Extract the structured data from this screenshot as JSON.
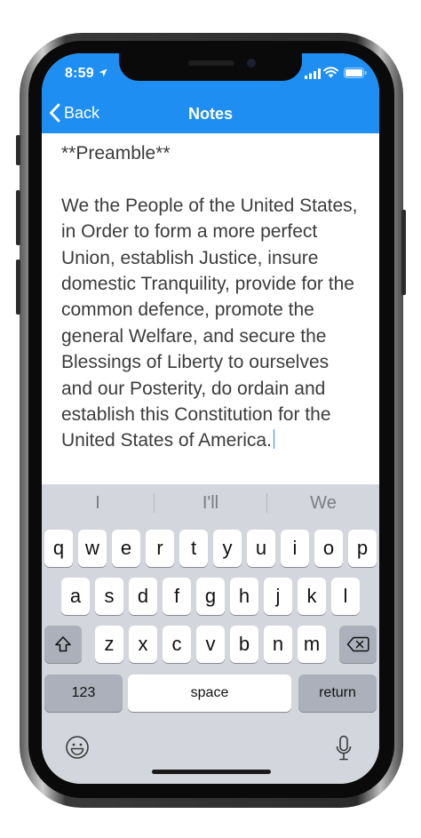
{
  "status": {
    "time": "8:59"
  },
  "nav": {
    "back_label": "Back",
    "title": "Notes"
  },
  "note": {
    "heading": "**Preamble**",
    "body": "We the People of the United States, in Order to form a more perfect Union, establish Justice, insure domestic Tranquility, provide for the common defence, promote the general Welfare, and secure the Blessings of Liberty to ourselves and our Posterity, do ordain and establish this Constitution for the United States of America."
  },
  "suggestions": [
    "I",
    "I'll",
    "We"
  ],
  "keyboard": {
    "row1": [
      "q",
      "w",
      "e",
      "r",
      "t",
      "y",
      "u",
      "i",
      "o",
      "p"
    ],
    "row2": [
      "a",
      "s",
      "d",
      "f",
      "g",
      "h",
      "j",
      "k",
      "l"
    ],
    "row3": [
      "z",
      "x",
      "c",
      "v",
      "b",
      "n",
      "m"
    ],
    "numbers_label": "123",
    "space_label": "space",
    "return_label": "return"
  },
  "icons": {
    "shift": "shift-icon",
    "delete": "delete-icon",
    "emoji": "emoji-icon",
    "mic": "microphone-icon"
  },
  "colors": {
    "nav_blue": "#1e8ef2",
    "keyboard_bg": "#d3d6dc"
  }
}
